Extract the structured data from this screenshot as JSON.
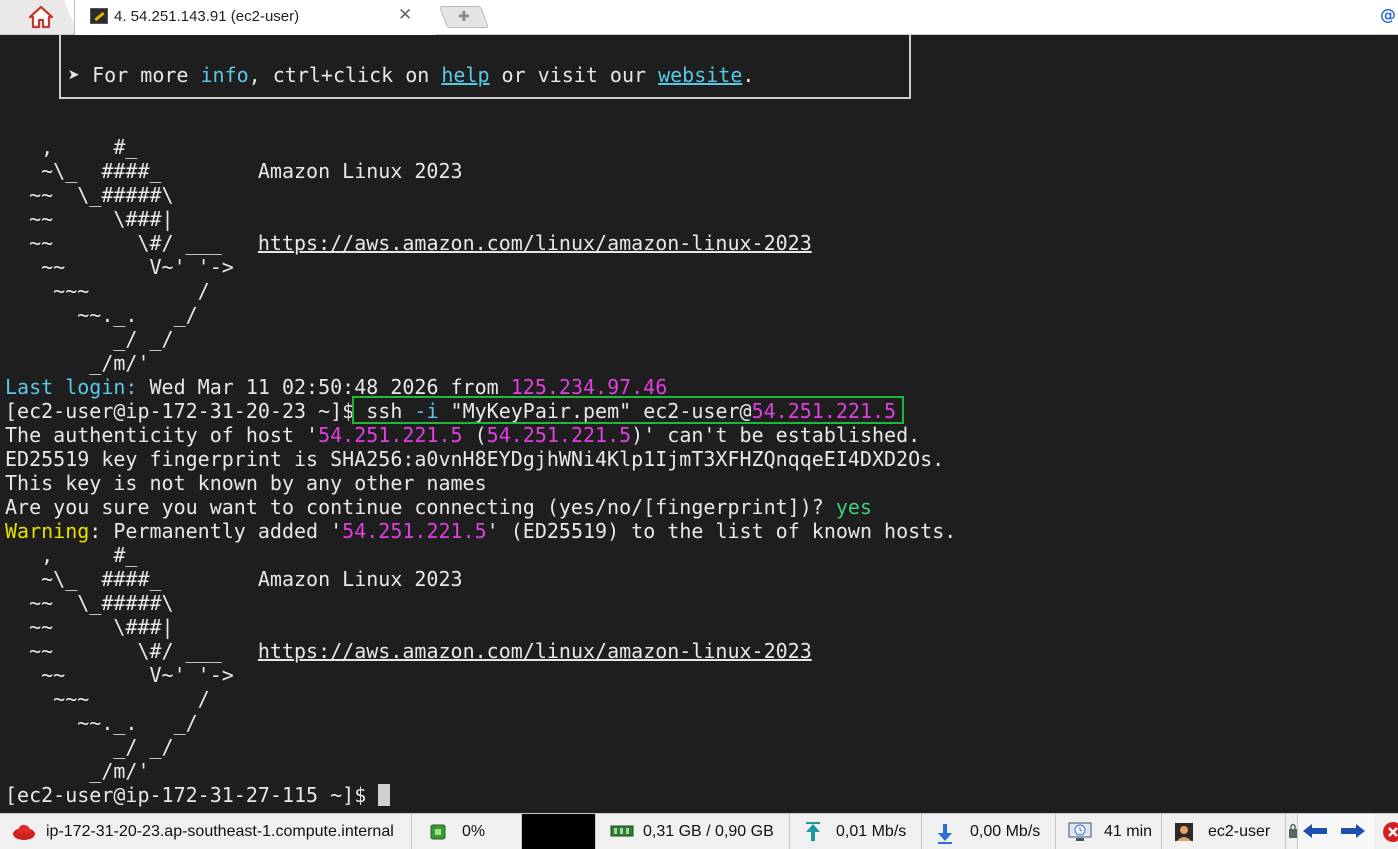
{
  "tabs": {
    "home_icon": "home-icon",
    "active": {
      "label": "4. 54.251.143.91 (ec2-user)",
      "close": "✕",
      "icon": "ssh-session-icon"
    },
    "new_tab_icon": "plus-icon"
  },
  "terminal": {
    "info_line": {
      "prefix": " ➤ For more ",
      "info": "info",
      "mid": ", ctrl+click on ",
      "help": "help",
      "mid2": " or visit our ",
      "website": "website",
      "end": "."
    },
    "banner1": [
      "   ,     #_",
      "   ~\\_  ####_        Amazon Linux 2023",
      "  ~~  \\_#####\\",
      "  ~~     \\###|",
      "  ~~       \\#/ ___   ",
      "   ~~       V~' '->",
      "    ~~~         /",
      "      ~~._.   _/",
      "         _/ _/",
      "       _/m/'"
    ],
    "banner_url": "https://aws.amazon.com/linux/amazon-linux-2023",
    "last_login": {
      "label": "Last login:",
      "text": " Wed Mar 11 02:50:48 2026 from ",
      "ip": "125.234.97.46"
    },
    "prompt1": "[ec2-user@ip-172-31-20-23 ~]$ ",
    "command": {
      "ssh": "ssh ",
      "flag": "-i",
      "rest": " \"MyKeyPair.pem\" ec2-user@",
      "host": "54.251.221.5"
    },
    "auth_line": {
      "a": "The authenticity of host '",
      "h1": "54.251.221.5",
      "b": " (",
      "h2": "54.251.221.5",
      "c": ")' can't be established."
    },
    "fingerprint": "ED25519 key fingerprint is SHA256:a0vnH8EYDgjhWNi4Klp1IjmT3XFHZQnqqeEI4DXD2Os.",
    "not_known": "This key is not known by any other names",
    "continue": {
      "q": "Are you sure you want to continue connecting (yes/no/[fingerprint])? ",
      "a": "yes"
    },
    "warning": {
      "label": "Warning",
      "a": ": Permanently added '",
      "h": "54.251.221.5",
      "b": "' (ED25519) to the list of known hosts."
    },
    "prompt2": "[ec2-user@ip-172-31-27-115 ~]$ "
  },
  "status": {
    "host": "ip-172-31-20-23.ap-southeast-1.compute.internal",
    "cpu": "0%",
    "memory": "0,31 GB / 0,90 GB",
    "upload": "0,01 Mb/s",
    "download": "0,00 Mb/s",
    "uptime": "41 min",
    "user": "ec2-user"
  },
  "colors": {
    "highlight_box": "#1fb83a",
    "cyan": "#5ac8e8",
    "magenta": "#e040e0"
  }
}
